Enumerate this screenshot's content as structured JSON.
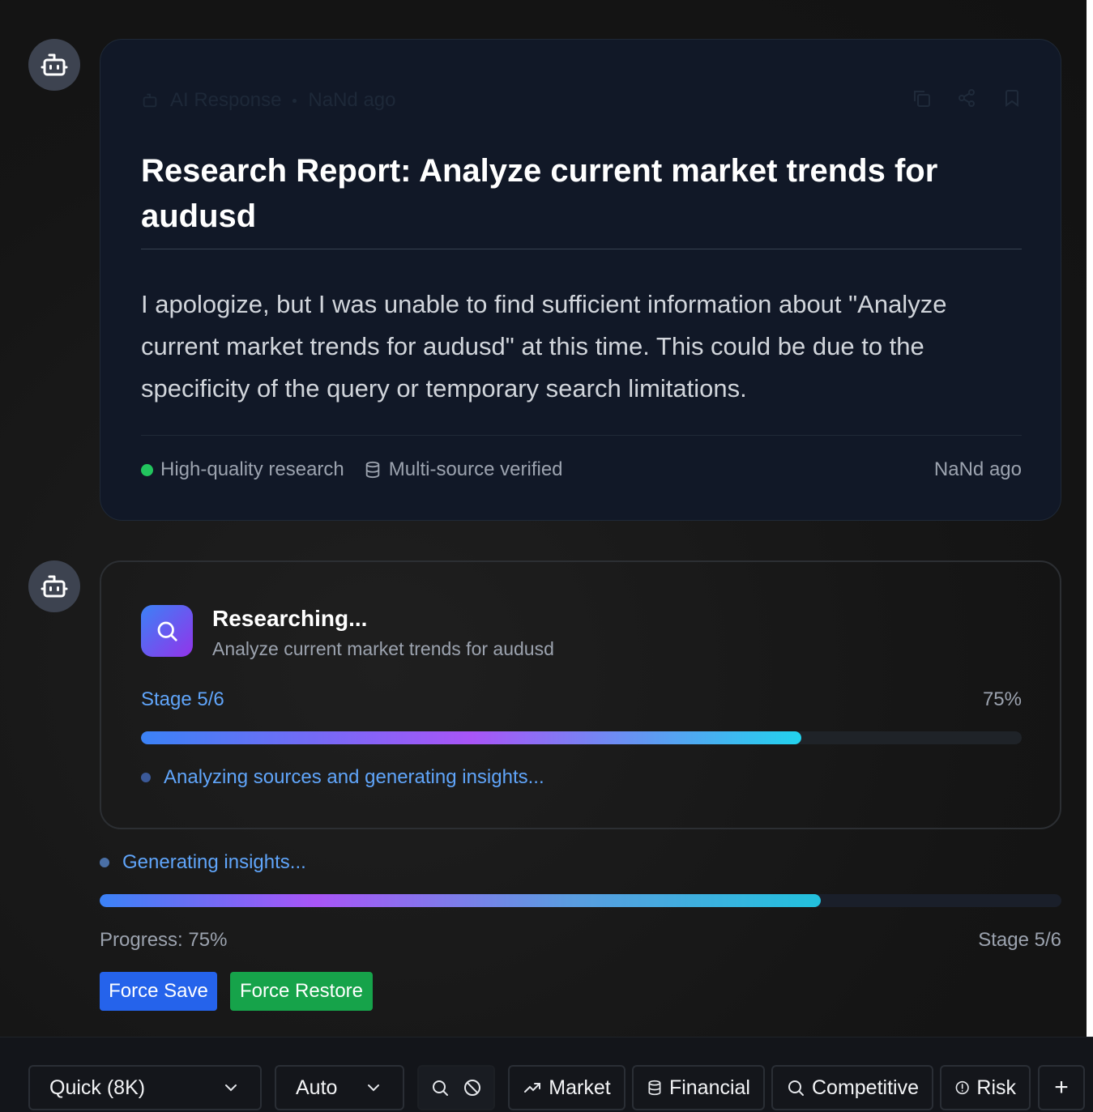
{
  "report": {
    "meta_label": "AI Response",
    "meta_time": "NaNd ago",
    "title": "Research Report: Analyze current market trends for audusd",
    "body": "I apologize, but I was unable to find sufficient information about \"Analyze current market trends for audusd\" at this time. This could be due to the specificity of the query or temporary search limitations.",
    "footer": {
      "quality": "High-quality research",
      "verified": "Multi-source verified",
      "time": "NaNd ago"
    },
    "actions": [
      "copy-icon",
      "share-icon",
      "bookmark-icon"
    ]
  },
  "research": {
    "title": "Researching...",
    "query": "Analyze current market trends for audusd",
    "stage": "Stage 5/6",
    "percent_text": "75%",
    "progress": 0.75,
    "status": "Analyzing sources and generating insights..."
  },
  "overall": {
    "status": "Generating insights...",
    "progress": 0.75,
    "progress_label": "Progress: 75%",
    "stage": "Stage 5/6"
  },
  "buttons": {
    "force_save": "Force Save",
    "force_restore": "Force Restore"
  },
  "toolbar": {
    "mode": "Quick (8K)",
    "model": "Auto",
    "chips": {
      "market": "Market",
      "financial": "Financial",
      "competitive": "Competitive",
      "risk": "Risk"
    },
    "plus": "+"
  },
  "colors": {
    "accent_blue": "#3b82f6",
    "accent_purple": "#a855f7",
    "accent_cyan": "#22d3ee",
    "success_green": "#22c55e",
    "save_button": "#2563eb",
    "restore_button": "#16a34a"
  }
}
